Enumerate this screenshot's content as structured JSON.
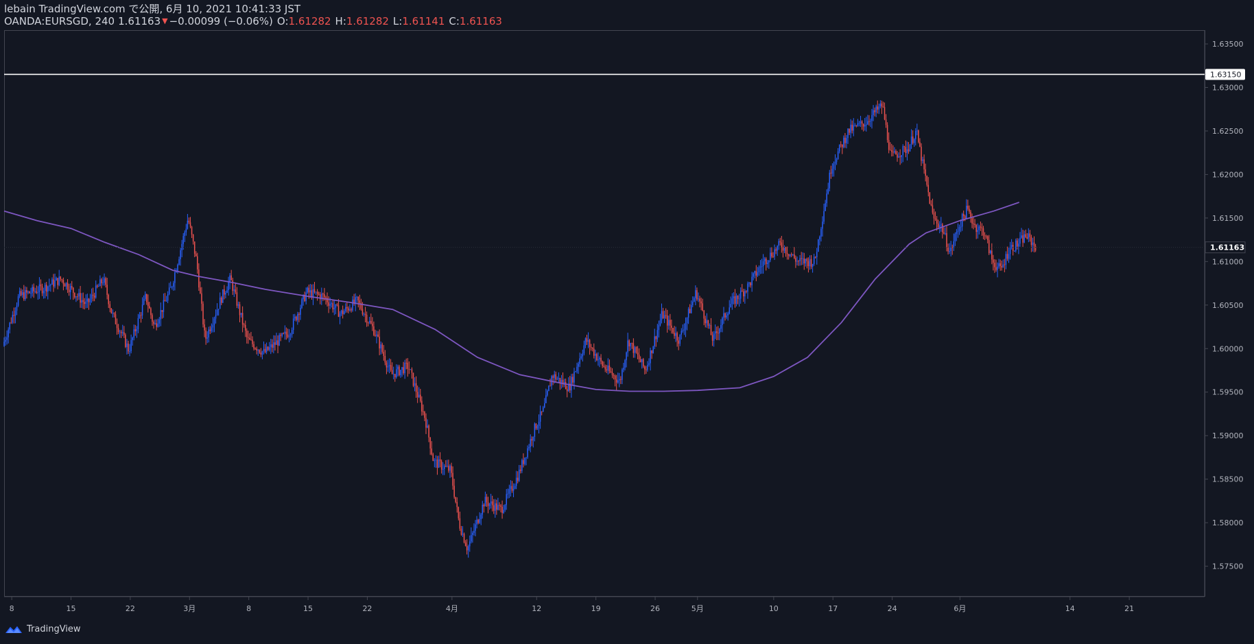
{
  "header": {
    "publish_line": "lebain TradingView.com で公開, 6月 10, 2021 10:41:33 JST",
    "symbol": "OANDA:EURSGD, 240",
    "last": "1.61163",
    "down_arrow": "▼",
    "change": "−0.00099 (−0.06%)",
    "o_label": "O:",
    "o_value": "1.61282",
    "h_label": "H:",
    "h_value": "1.61282",
    "l_label": "L:",
    "l_value": "1.61141",
    "c_label": "C:",
    "c_value": "1.61163"
  },
  "footer": {
    "brand": "TradingView"
  },
  "colors": {
    "up": "#2962ff",
    "down": "#ef5350",
    "ma": "#7e57c2",
    "hline": "#ffffff",
    "bg": "#131722"
  },
  "chart_data": {
    "type": "candlestick",
    "timeframe": "240",
    "y_ticks": [
      "1.63500",
      "1.63000",
      "1.62500",
      "1.62000",
      "1.61500",
      "1.61000",
      "1.60500",
      "1.60000",
      "1.59500",
      "1.59000",
      "1.58500",
      "1.58000",
      "1.57500"
    ],
    "ylim": [
      1.5715,
      1.6365
    ],
    "x_ticks": [
      {
        "label": "8",
        "day": 0
      },
      {
        "label": "15",
        "day": 7
      },
      {
        "label": "22",
        "day": 14
      },
      {
        "label": "3月",
        "day": 21
      },
      {
        "label": "8",
        "day": 28
      },
      {
        "label": "15",
        "day": 35
      },
      {
        "label": "22",
        "day": 42
      },
      {
        "label": "4月",
        "day": 52
      },
      {
        "label": "12",
        "day": 62
      },
      {
        "label": "19",
        "day": 69
      },
      {
        "label": "26",
        "day": 76
      },
      {
        "label": "5月",
        "day": 81
      },
      {
        "label": "10",
        "day": 90
      },
      {
        "label": "17",
        "day": 97
      },
      {
        "label": "24",
        "day": 104
      },
      {
        "label": "6月",
        "day": 112
      },
      {
        "label": "14",
        "day": 125
      },
      {
        "label": "21",
        "day": 132
      }
    ],
    "x_range_days": [
      -0.9,
      140.9
    ],
    "horizontal_line": {
      "value": 1.6315,
      "label": "1.63150"
    },
    "last_price": {
      "value": 1.61163,
      "label": "1.61163"
    },
    "ma_points": [
      [
        -0.9,
        1.6158
      ],
      [
        3,
        1.6147
      ],
      [
        7,
        1.6138
      ],
      [
        11,
        1.6122
      ],
      [
        15,
        1.6108
      ],
      [
        19,
        1.609
      ],
      [
        22,
        1.6083
      ],
      [
        26,
        1.6076
      ],
      [
        30,
        1.6068
      ],
      [
        35,
        1.606
      ],
      [
        40,
        1.6053
      ],
      [
        45,
        1.6045
      ],
      [
        50,
        1.6022
      ],
      [
        55,
        1.599
      ],
      [
        60,
        1.597
      ],
      [
        65,
        1.596
      ],
      [
        69,
        1.5953
      ],
      [
        73,
        1.5951
      ],
      [
        77,
        1.5951
      ],
      [
        81,
        1.5952
      ],
      [
        86,
        1.5955
      ],
      [
        90,
        1.5968
      ],
      [
        94,
        1.599
      ],
      [
        98,
        1.603
      ],
      [
        102,
        1.608
      ],
      [
        106,
        1.612
      ],
      [
        108,
        1.6133
      ],
      [
        112,
        1.6147
      ],
      [
        116,
        1.6158
      ],
      [
        119,
        1.6168
      ]
    ],
    "price_anchors": [
      [
        -0.9,
        1.6003
      ],
      [
        1,
        1.606
      ],
      [
        4,
        1.607
      ],
      [
        6,
        1.608
      ],
      [
        9,
        1.605
      ],
      [
        11,
        1.608
      ],
      [
        12,
        1.604
      ],
      [
        13,
        1.602
      ],
      [
        14,
        1.5998
      ],
      [
        16,
        1.606
      ],
      [
        17,
        1.6025
      ],
      [
        19,
        1.607
      ],
      [
        21,
        1.615
      ],
      [
        22,
        1.61
      ],
      [
        23,
        1.601
      ],
      [
        25,
        1.606
      ],
      [
        26,
        1.608
      ],
      [
        28,
        1.601
      ],
      [
        30,
        1.5995
      ],
      [
        33,
        1.602
      ],
      [
        35,
        1.6065
      ],
      [
        37,
        1.606
      ],
      [
        39,
        1.604
      ],
      [
        41,
        1.6055
      ],
      [
        43,
        1.602
      ],
      [
        45,
        1.597
      ],
      [
        47,
        1.598
      ],
      [
        49,
        1.592
      ],
      [
        50,
        1.587
      ],
      [
        52,
        1.586
      ],
      [
        53,
        1.58
      ],
      [
        54,
        1.577
      ],
      [
        56,
        1.5825
      ],
      [
        58,
        1.5815
      ],
      [
        60,
        1.5855
      ],
      [
        62,
        1.591
      ],
      [
        63,
        1.593
      ],
      [
        64,
        1.597
      ],
      [
        66,
        1.5955
      ],
      [
        68,
        1.601
      ],
      [
        70,
        1.598
      ],
      [
        72,
        1.5962
      ],
      [
        73,
        1.601
      ],
      [
        75,
        1.5975
      ],
      [
        77,
        1.604
      ],
      [
        79,
        1.601
      ],
      [
        81,
        1.6065
      ],
      [
        83,
        1.601
      ],
      [
        85,
        1.605
      ],
      [
        87,
        1.607
      ],
      [
        89,
        1.61
      ],
      [
        91,
        1.612
      ],
      [
        93,
        1.61
      ],
      [
        95,
        1.61
      ],
      [
        97,
        1.621
      ],
      [
        99,
        1.625
      ],
      [
        101,
        1.626
      ],
      [
        103,
        1.628
      ],
      [
        104,
        1.622
      ],
      [
        106,
        1.623
      ],
      [
        107,
        1.625
      ],
      [
        108,
        1.62
      ],
      [
        109,
        1.615
      ],
      [
        110,
        1.614
      ],
      [
        111,
        1.611
      ],
      [
        112,
        1.614
      ],
      [
        113,
        1.616
      ],
      [
        114,
        1.614
      ],
      [
        115,
        1.6135
      ],
      [
        116,
        1.61
      ],
      [
        117,
        1.609
      ],
      [
        118,
        1.6115
      ],
      [
        119,
        1.612
      ],
      [
        120,
        1.613
      ],
      [
        121,
        1.6118
      ]
    ]
  }
}
